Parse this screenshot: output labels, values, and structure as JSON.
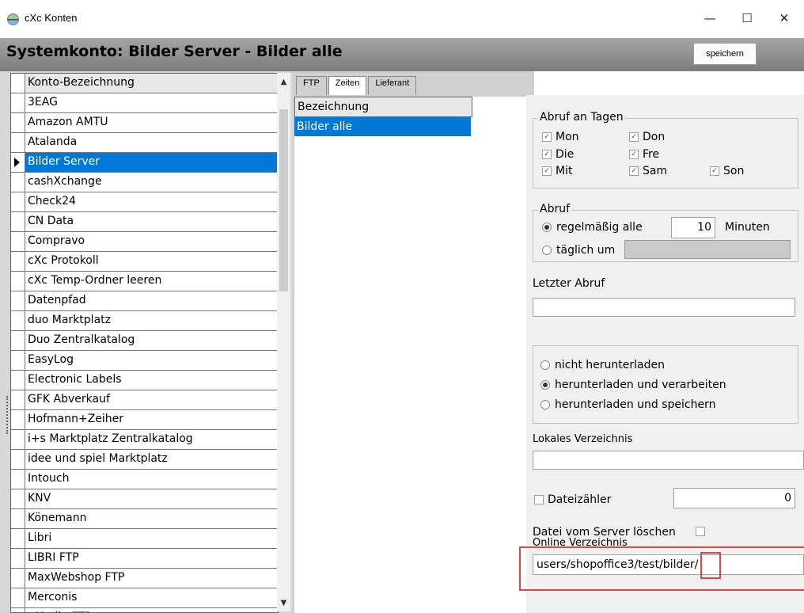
{
  "window": {
    "title": "cXc Konten",
    "controls": {
      "minimize": "—",
      "maximize": "☐",
      "close": "✕"
    }
  },
  "header": {
    "title": "Systemkonto: Bilder Server - Bilder alle",
    "save_label": "speichern"
  },
  "accounts": {
    "column_header": "Konto-Bezeichnung",
    "items": [
      "3EAG",
      "Amazon AMTU",
      "Atalanda",
      "Bilder Server",
      "cashXchange",
      "Check24",
      "CN Data",
      "Compravo",
      "cXc Protokoll",
      "cXc Temp-Ordner leeren",
      "Datenpfad",
      "duo Marktplatz",
      "Duo Zentralkatalog",
      "EasyLog",
      "Electronic Labels",
      "GFK Abverkauf",
      "Hofmann+Zeiher",
      "i+s Marktplatz Zentralkatalog",
      "idee und spiel Marktplatz",
      "Intouch",
      "KNV",
      "Könemann",
      "Libri",
      "LIBRI FTP",
      "MaxWebshop FTP",
      "Merconis",
      "nMedia FTP"
    ],
    "selected_index": 3,
    "scroll_up": "▲",
    "scroll_down": "▼"
  },
  "tabs": [
    {
      "label": "FTP"
    },
    {
      "label": "Zeiten"
    },
    {
      "label": "Lieferant"
    }
  ],
  "mid_list": {
    "header": "Bezeichnung",
    "selected_item": "Bilder alle"
  },
  "schedule": {
    "days_title": "Abruf an Tagen",
    "days": [
      "Mon",
      "Don",
      "Die",
      "Fre",
      "Mit",
      "Sam",
      "Son"
    ],
    "checkmark": "✓",
    "abruf_title": "Abruf",
    "regular_label": "regelmäßig alle",
    "interval_value": "10",
    "interval_unit": "Minuten",
    "daily_label": "täglich um",
    "last_fetch_label": "Letzter Abruf",
    "last_fetch_value": "",
    "options": [
      "nicht herunterladen",
      "herunterladen und verarbeiten",
      "herunterladen und speichern"
    ],
    "selected_option": 1,
    "local_dir_label": "Lokales Verzeichnis",
    "local_dir_value": "",
    "file_counter_label": "Dateizähler",
    "file_counter_value": "0",
    "delete_label": "Datei vom Server löschen",
    "online_dir_label": "Online Verzeichnis",
    "online_dir_value": "users/shopoffice3/test/bilder/"
  },
  "colors": {
    "selection": "#0078d7",
    "header_gradient_top": "#a6a6a6",
    "highlight_red": "#e04646"
  }
}
